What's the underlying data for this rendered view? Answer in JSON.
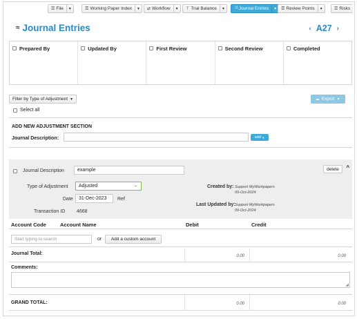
{
  "toolbar": {
    "items": [
      {
        "label": "File",
        "icon": "list-icon"
      },
      {
        "label": "Working Paper Index",
        "icon": "list-icon"
      },
      {
        "label": "Workflow",
        "icon": "workflow-icon"
      },
      {
        "label": "Trial Balance",
        "icon": "balance-icon"
      },
      {
        "label": "Journal Entries",
        "icon": "shuffle-icon",
        "active": true
      },
      {
        "label": "Review Points",
        "icon": "list-icon"
      },
      {
        "label": "Risks",
        "icon": "list-icon"
      }
    ],
    "active_color": "#3fa9d8"
  },
  "header": {
    "title": "Journal Entries",
    "collapse_icon": "double-chevron-up-icon",
    "ref": "A27",
    "prev_icon": "chevron-left-icon",
    "next_icon": "chevron-right-icon",
    "accent": "#2a8ac4"
  },
  "signoff": [
    "Prepared By",
    "Updated By",
    "First Review",
    "Second Review",
    "Completed"
  ],
  "filter": {
    "label": "Filter by Type of Adjustment"
  },
  "export": {
    "label": "Export"
  },
  "select_all": "Select all",
  "add_section": {
    "title": "ADD NEW ADJUSTMENT SECTION",
    "journal_description_label": "Journal Description:",
    "journal_description_value": "",
    "add_label": "add"
  },
  "entry": {
    "description_label": "Journal Description",
    "description_value": "example",
    "type_label": "Type of Adjustment",
    "type_value": "Adjusted",
    "date_label": "Date",
    "date_value": "31-Dec-2023",
    "ref_label": "Ref",
    "txn_label": "Transaction ID",
    "txn_value": "4668",
    "created_by_label": "Created by:",
    "created_by_value": "Support MyWorkpapers",
    "created_date": "09-Oct-2024",
    "updated_by_label": "Last Updated by:",
    "updated_by_value": "Support MyWorkpapers",
    "updated_date": "09-Oct-2024",
    "delete_label": "delete"
  },
  "accounts": {
    "headers": [
      "Account Code",
      "Account Name",
      "Debit",
      "Credit"
    ],
    "search_placeholder": "Start typing to search",
    "or": "or",
    "custom_label": "Add a custom account"
  },
  "journal_total": {
    "label": "Journal Total:",
    "debit": "0.00",
    "credit": "0.00"
  },
  "comments_label": "Comments:",
  "grand_total": {
    "label": "GRAND TOTAL:",
    "debit": "0.00",
    "credit": "0.00"
  }
}
